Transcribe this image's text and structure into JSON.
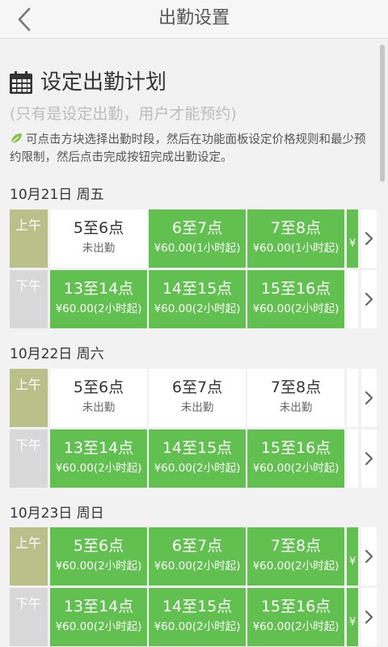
{
  "header": {
    "title": "出勤设置"
  },
  "intro": {
    "title": "设定出勤计划",
    "subtitle": "(只有是设定出勤，用户才能预约)",
    "hint": "可点击方块选择出勤时段，然后在功能面板设定价格规则和最少预约限制，然后点击完成按钮完成出勤设定。"
  },
  "days": [
    {
      "date": "10月21日 周五",
      "am": {
        "label": "上午",
        "slots": [
          {
            "time": "5至6点",
            "info": "未出勤",
            "active": false
          },
          {
            "time": "6至7点",
            "info": "¥60.00(1小时起)",
            "active": true
          },
          {
            "time": "7至8点",
            "info": "¥60.00(1小时起)",
            "active": true
          }
        ],
        "partial_text": "¥"
      },
      "pm": {
        "label": "下午",
        "slots": [
          {
            "time": "13至14点",
            "info": "¥60.00(2小时起)",
            "active": true
          },
          {
            "time": "14至15点",
            "info": "¥60.00(2小时起)",
            "active": true
          },
          {
            "time": "15至16点",
            "info": "¥60.00(2小时起)",
            "active": true
          }
        ]
      }
    },
    {
      "date": "10月22日 周六",
      "am": {
        "label": "上午",
        "slots": [
          {
            "time": "5至6点",
            "info": "未出勤",
            "active": false
          },
          {
            "time": "6至7点",
            "info": "未出勤",
            "active": false
          },
          {
            "time": "7至8点",
            "info": "未出勤",
            "active": false
          }
        ]
      },
      "pm": {
        "label": "下午",
        "slots": [
          {
            "time": "13至14点",
            "info": "¥60.00(2小时起)",
            "active": true
          },
          {
            "time": "14至15点",
            "info": "¥60.00(2小时起)",
            "active": true
          },
          {
            "time": "15至16点",
            "info": "¥60.00(2小时起)",
            "active": true
          }
        ]
      }
    },
    {
      "date": "10月23日 周日",
      "am": {
        "label": "上午",
        "slots": [
          {
            "time": "5至6点",
            "info": "¥60.00(2小时起)",
            "active": true
          },
          {
            "time": "6至7点",
            "info": "¥60.00(2小时起)",
            "active": true
          },
          {
            "time": "7至8点",
            "info": "¥60.00(2小时起)",
            "active": true
          }
        ],
        "partial_text": "¥"
      },
      "pm": {
        "label": "下午",
        "slots": [
          {
            "time": "13至14点",
            "info": "¥60.00(2小时起)",
            "active": true
          },
          {
            "time": "14至15点",
            "info": "¥60.00(2小时起)",
            "active": true
          },
          {
            "time": "15至16点",
            "info": "¥60.00(2小时起)",
            "active": true
          }
        ],
        "partial_text": "¥"
      }
    }
  ],
  "colors": {
    "active": "#61c04f",
    "am_label": "#b9c08a",
    "pm_label": "#d8d8d8",
    "leaf": "#8bc34a"
  }
}
